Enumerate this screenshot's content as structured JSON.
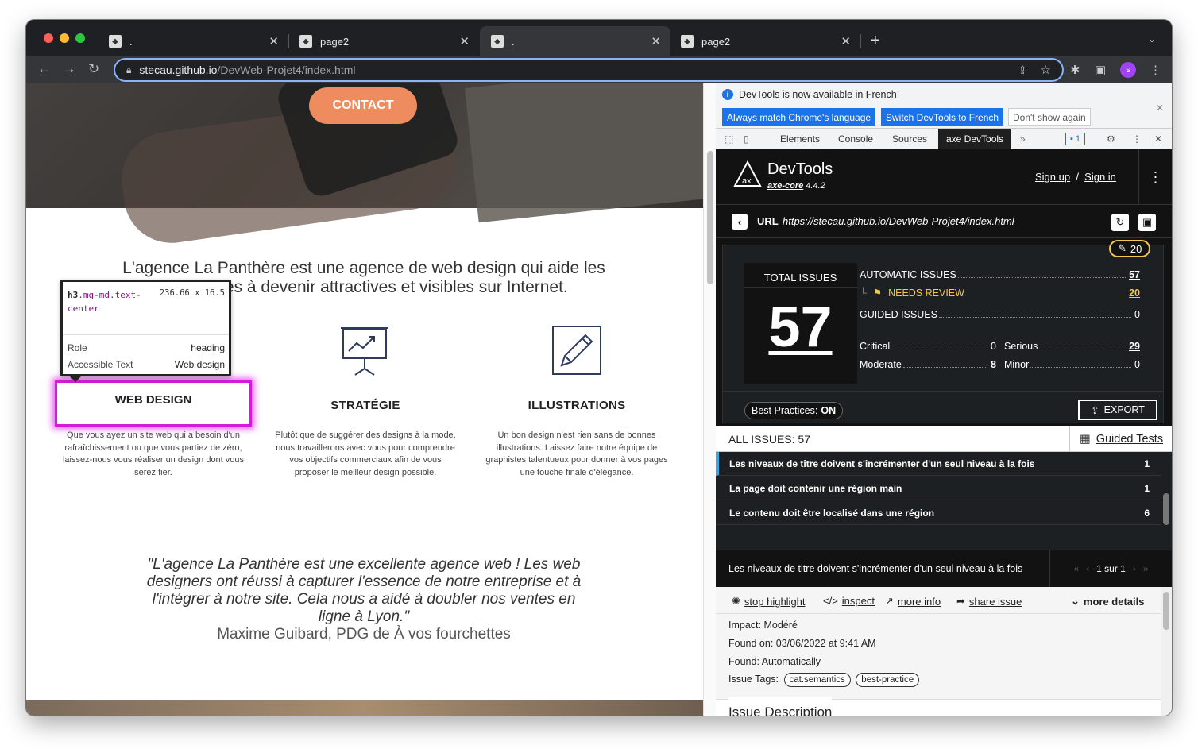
{
  "browser": {
    "tabs": [
      {
        "title": "."
      },
      {
        "title": "page2"
      },
      {
        "title": "."
      },
      {
        "title": "page2"
      }
    ],
    "url_host": "stecau.github.io",
    "url_path": "/DevWeb-Projet4/index.html",
    "profile_initial": "s"
  },
  "site": {
    "contact_label": "CONTACT",
    "intro": "L'agence La Panthère est une agence de web design qui aide les entreprises à devenir attractives et visibles sur Internet.",
    "services": [
      {
        "title": "WEB DESIGN",
        "text": "Que vous ayez un site web qui a besoin d'un rafraîchissement ou que vous partiez de zéro, laissez-nous vous réaliser un design dont vous serez fier.",
        "icon": "monitor-icon"
      },
      {
        "title": "STRATÉGIE",
        "text": "Plutôt que de suggérer des designs à la mode, nous travaillerons avec vous pour comprendre vos objectifs commerciaux afin de vous proposer le meilleur design possible.",
        "icon": "presentation-chart-icon"
      },
      {
        "title": "ILLUSTRATIONS",
        "text": "Un bon design n'est rien sans de bonnes illustrations. Laissez faire notre équipe de graphistes talentueux pour donner à vos pages une touche finale d'élégance.",
        "icon": "pencil-icon"
      }
    ],
    "quote": "\"L'agence La Panthère est une excellente agence web ! Les web designers ont réussi à capturer l'essence de notre entreprise et à l'intégrer à notre site. Cela nous a aidé à doubler nos ventes en ligne à Lyon.\"",
    "author": "Maxime Guibard, PDG de À vos fourchettes"
  },
  "inspect_tooltip": {
    "tag": "h3",
    "classes": ".mg-md.text-center",
    "dimensions": "236.66 x 16.5",
    "role_label": "Role",
    "role_value": "heading",
    "name_label": "Accessible Text",
    "name_value": "Web design"
  },
  "devtools": {
    "banner_message": "DevTools is now available in French!",
    "btn_always_match": "Always match Chrome's language",
    "btn_switch": "Switch DevTools to French",
    "btn_dont_show": "Don't show again",
    "tabs": [
      "Elements",
      "Console",
      "Sources",
      "axe DevTools"
    ],
    "issues_badge": "1"
  },
  "axe": {
    "title": "DevTools",
    "core_name": "axe-core",
    "core_version": "4.4.2",
    "sign_up": "Sign up",
    "sign_in": "Sign in",
    "url_label": "URL",
    "url": "https://stecau.github.io/DevWeb-Projet4/index.html",
    "needs_review_pill": "20",
    "total_label": "TOTAL ISSUES",
    "total": "57",
    "automatic_label": "AUTOMATIC ISSUES",
    "automatic": "57",
    "needs_review_label": "NEEDS REVIEW",
    "needs_review": "20",
    "guided_label": "GUIDED ISSUES",
    "guided": "0",
    "critical_label": "Critical",
    "critical": "0",
    "serious_label": "Serious",
    "serious": "29",
    "moderate_label": "Moderate",
    "moderate": "8",
    "minor_label": "Minor",
    "minor": "0",
    "best_practices_label": "Best Practices:",
    "best_practices_state": "ON",
    "export_label": "EXPORT",
    "all_issues_label": "ALL ISSUES: 57",
    "guided_tests_label": "Guided Tests",
    "issues": [
      {
        "title": "Les niveaux de titre doivent s'incrémenter d'un seul niveau à la fois",
        "count": "1"
      },
      {
        "title": "La page doit contenir une région main",
        "count": "1"
      },
      {
        "title": "Le contenu doit être localisé dans une région",
        "count": "6"
      }
    ],
    "detail_title": "Les niveaux de titre doivent s'incrémenter d'un seul niveau à la fois",
    "pagination": "1 sur 1",
    "actions": {
      "stop_highlight": "stop highlight",
      "inspect": "inspect",
      "more_info": "more info",
      "share_issue": "share issue",
      "more_details": "more details"
    },
    "impact_label": "Impact:",
    "impact": "Modéré",
    "found_on_label": "Found on:",
    "found_on": "03/06/2022 at 9:41 AM",
    "found_label": "Found:",
    "found": "Automatically",
    "tags_label": "Issue Tags:",
    "tags": [
      "cat.semantics",
      "best-practice"
    ],
    "description_heading": "Issue Description"
  },
  "colors": {
    "accent_orange": "#ef8c5f",
    "highlight_magenta": "#d21cd8",
    "axe_yellow": "#f2c94c",
    "chrome_blue": "#1a73e8"
  }
}
